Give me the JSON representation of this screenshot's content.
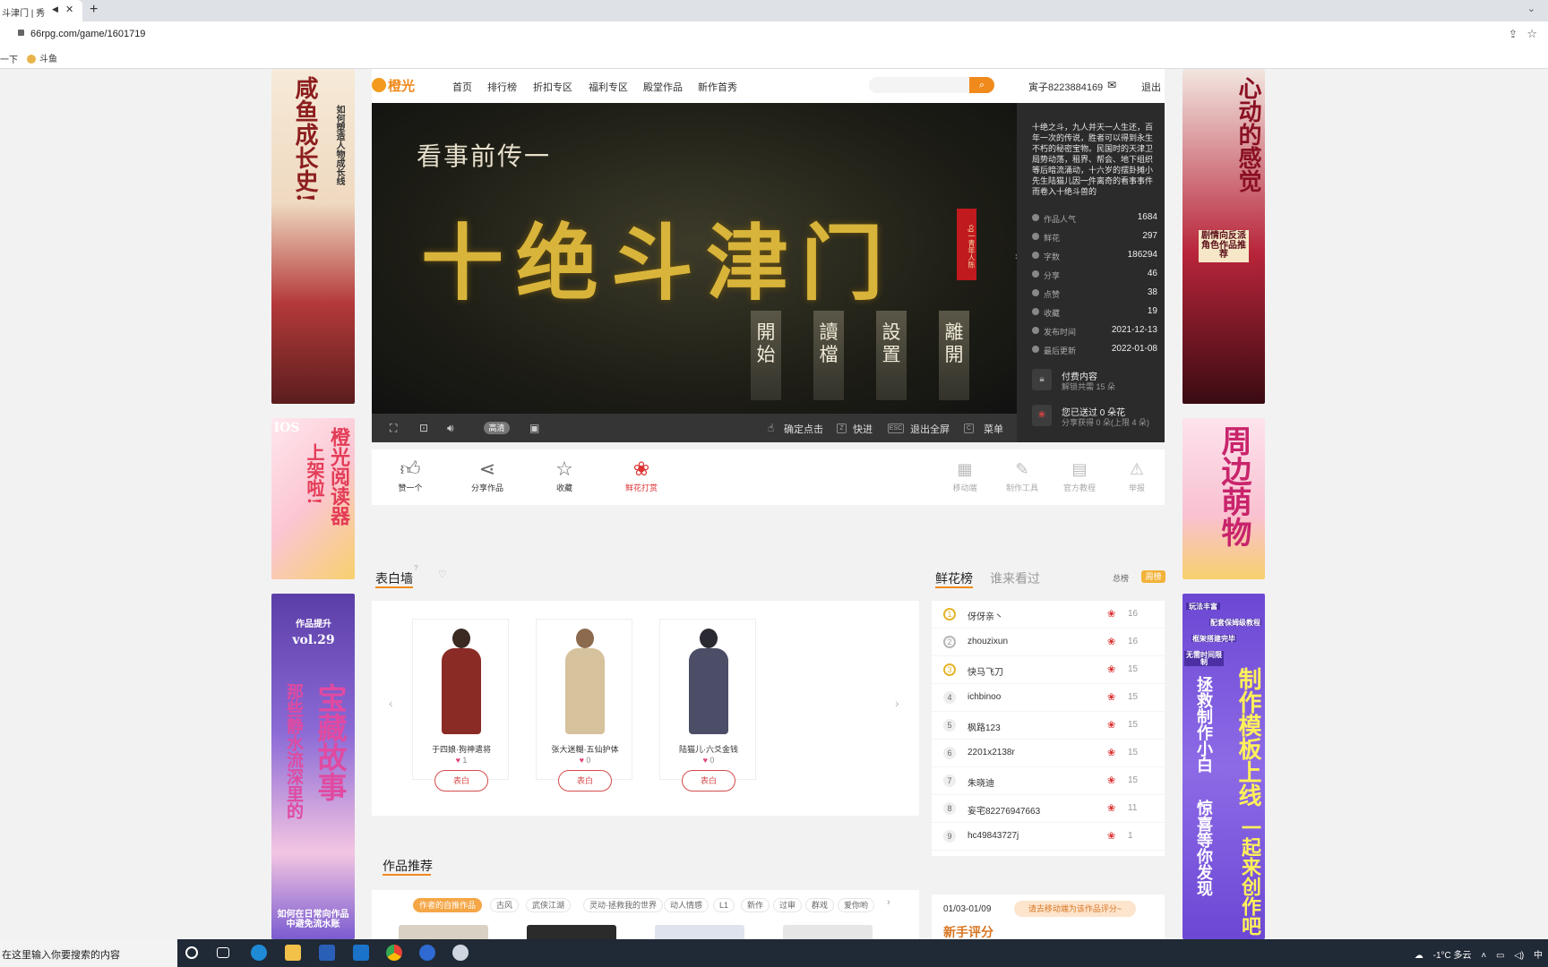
{
  "browser": {
    "tab_title": "斗津门 | 秀",
    "tab_mute_icon": "speaker-icon",
    "url": "66rpg.com/game/1601719",
    "bookmarks": [
      "一下",
      "斗鱼"
    ]
  },
  "site": {
    "logo_text": "橙光",
    "nav": [
      "首页",
      "排行榜",
      "折扣专区",
      "福利专区",
      "殿堂作品",
      "新作首秀"
    ],
    "search_placeholder": "",
    "search_button_icon": "search-icon",
    "username": "寅子8223884169",
    "logout": "退出"
  },
  "ads": {
    "left_top": [
      "咸鱼成长史!",
      "如何塑造人物成长线"
    ],
    "left_mid": [
      "橙光阅读器",
      "上架啦!",
      "IOS"
    ],
    "left_bottom": [
      "作品提升",
      "vol.29",
      "那些静水流深里的",
      "宝藏故事",
      "如何在日常向作品中避免流水账"
    ],
    "right_top": [
      "心动的感觉",
      "剧情向反派角色作品推荐"
    ],
    "right_mid": [
      "周边萌物"
    ],
    "right_bottom": [
      "玩法丰富",
      "配套保姆级教程",
      "框架搭建完毕",
      "无需时间限制",
      "制作模板上线",
      "拯救制作小白",
      "惊喜等你发现",
      "一起来创作吧"
    ]
  },
  "game": {
    "subtitle": "看事前传一",
    "title": "十绝斗津门",
    "seal": "cg一青年人陈",
    "menu_buttons": [
      "開始",
      "讀檔",
      "設置",
      "離開"
    ],
    "controls": {
      "fullscreen_icon": "fullscreen-icon",
      "expand_icon": "expand-icon",
      "volume_icon": "volume-icon",
      "hd_label": "高清",
      "screenshot_icon": "screenshot-icon",
      "confirm_label": "确定点击",
      "fast_key": "Z",
      "fast_label": "快进",
      "esc_key": "ESC",
      "exit_full_label": "退出全屏",
      "menu_key": "C",
      "menu_label": "菜单"
    }
  },
  "info": {
    "description": "十绝之斗，九人并天一人生还，百年一次的传说，胜者可以得到永生不朽的秘密宝物。民国时的天津卫局势动荡，租界、帮会、地下组织等后暗流涌动，十六岁的摆卦摊小先生陆猫儿因一件离奇的看事事件而卷入十绝斗兽的",
    "stats": [
      {
        "icon": "fire-icon",
        "label": "作品人气",
        "value": "1684"
      },
      {
        "icon": "flower-icon",
        "label": "鲜花",
        "value": "297"
      },
      {
        "icon": "text-icon",
        "label": "字数",
        "value": "186294"
      },
      {
        "icon": "share-icon",
        "label": "分享",
        "value": "46"
      },
      {
        "icon": "like-icon",
        "label": "点赞",
        "value": "38"
      },
      {
        "icon": "star-icon",
        "label": "收藏",
        "value": "19"
      },
      {
        "icon": "publish-icon",
        "label": "发布时间",
        "value": "2021-12-13"
      },
      {
        "icon": "clock-icon",
        "label": "最后更新",
        "value": "2022-01-08"
      }
    ],
    "paid_title": "付费内容",
    "paid_sub": "解锁共需 15 朵",
    "flowers_title": "您已送过 0 朵花",
    "flowers_sub": "分享获得 0 朵(上限 4 朵)"
  },
  "actions": {
    "left": [
      {
        "icon": "thumbs-up-icon",
        "label": "赞一个"
      },
      {
        "icon": "share-icon",
        "label": "分享作品"
      },
      {
        "icon": "star-icon",
        "label": "收藏"
      },
      {
        "icon": "flower-icon",
        "label": "鲜花打赏"
      }
    ],
    "right": [
      {
        "icon": "qrcode-icon",
        "label": "移动端"
      },
      {
        "icon": "edit-icon",
        "label": "制作工具"
      },
      {
        "icon": "book-icon",
        "label": "官方教程"
      },
      {
        "icon": "warning-icon",
        "label": "举报"
      }
    ]
  },
  "wall": {
    "title": "表白墙",
    "help": "?",
    "cards": [
      {
        "name": "于四娘·狗神遣将",
        "count": "1",
        "button": "表白",
        "colors": [
          "#3a2a22",
          "#8a2b26"
        ]
      },
      {
        "name": "张大迷糊·五仙护体",
        "count": "0",
        "button": "表白",
        "colors": [
          "#8b6a4e",
          "#d6c29c"
        ]
      },
      {
        "name": "陆猫儿·六爻金钱",
        "count": "0",
        "button": "表白",
        "colors": [
          "#2a2a33",
          "#4b4e66"
        ]
      }
    ]
  },
  "ranking": {
    "tab_active": "鲜花榜",
    "tab_other": "谁来看过",
    "total_label": "总榜",
    "week_label": "周榜",
    "rows": [
      {
        "rank": "1",
        "name": "伢伢亲丶",
        "value": "16"
      },
      {
        "rank": "2",
        "name": "zhouzixun",
        "value": "16"
      },
      {
        "rank": "3",
        "name": "快马飞刀",
        "value": "15"
      },
      {
        "rank": "4",
        "name": "ichbinoo",
        "value": "15"
      },
      {
        "rank": "5",
        "name": "枫路123",
        "value": "15"
      },
      {
        "rank": "6",
        "name": "2201x2138r",
        "value": "15"
      },
      {
        "rank": "7",
        "name": "朱晓迪",
        "value": "15"
      },
      {
        "rank": "8",
        "name": "妄宅82276947663",
        "value": "11"
      },
      {
        "rank": "9",
        "name": "hc49843727j",
        "value": "1"
      }
    ]
  },
  "recommend": {
    "title": "作品推荐",
    "chips": [
      "作者的自推作品",
      "古风",
      "武侠江湖",
      "灵动·拯救我的世界",
      "动人情感",
      "L1",
      "新作",
      "过审",
      "群戏",
      "爱你哟"
    ]
  },
  "evaluation": {
    "date": "01/03-01/09",
    "tip": "请去移动端为该作品评分~",
    "heading": "新手评分"
  },
  "taskbar": {
    "search_placeholder": "在这里输入你要搜索的内容",
    "weather": "-1°C 多云",
    "ime": "中"
  }
}
